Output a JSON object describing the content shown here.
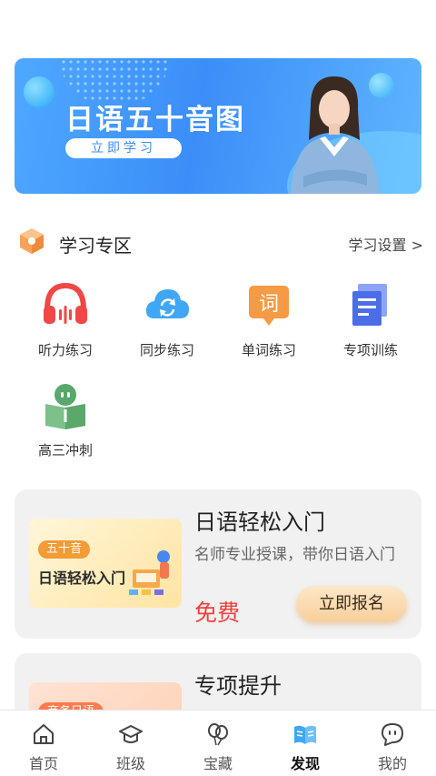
{
  "banner": {
    "title": "日语五十音图",
    "cta_label": "立即学习"
  },
  "section": {
    "title": "学习专区",
    "settings_label": "学习设置 >"
  },
  "grid": [
    {
      "label": "听力练习",
      "icon": "headphones-icon"
    },
    {
      "label": "同步练习",
      "icon": "cloud-sync-icon"
    },
    {
      "label": "单词练习",
      "icon": "word-icon"
    },
    {
      "label": "专项训练",
      "icon": "document-icon"
    },
    {
      "label": "高三冲刺",
      "icon": "book-icon"
    }
  ],
  "cards": [
    {
      "thumb_tag": "五十音",
      "thumb_title": "日语轻松入门",
      "title": "日语轻松入门",
      "description": "名师专业授课，带你日语入门",
      "price": "免费",
      "enroll_label": "立即报名"
    },
    {
      "thumb_tag": "商务日语",
      "title": "专项提升"
    }
  ],
  "nav": [
    {
      "label": "首页",
      "icon": "home-icon"
    },
    {
      "label": "班级",
      "icon": "graduation-cap-icon"
    },
    {
      "label": "宝藏",
      "icon": "balloon-icon"
    },
    {
      "label": "发现",
      "icon": "open-book-icon",
      "active": true
    },
    {
      "label": "我的",
      "icon": "chat-face-icon"
    }
  ],
  "colors": {
    "banner_blue": "#3b8ef8",
    "price_red": "#f0413d",
    "headphone_red": "#f04747",
    "cloud_blue": "#3fa7f5",
    "word_orange": "#f59a45",
    "doc_blue": "#4b6ee8",
    "book_green": "#4caf6a"
  }
}
